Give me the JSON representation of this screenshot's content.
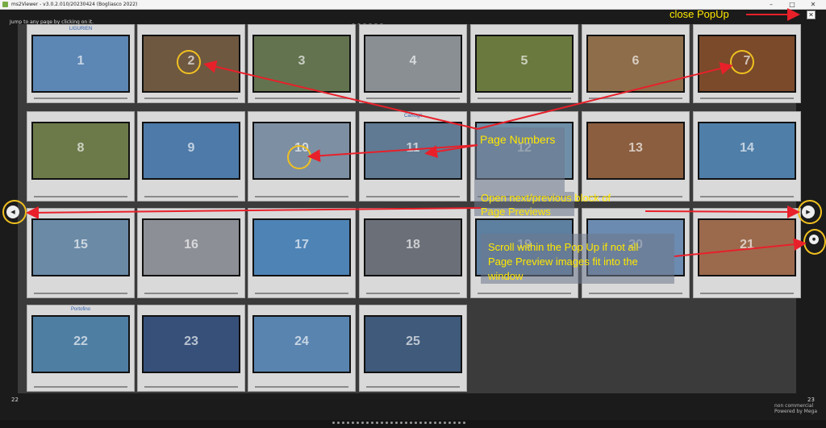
{
  "window": {
    "title": "ms2Viewer - v3.0.2.010/20230424 (Bogliasco 2022)",
    "minimize": "–",
    "maximize": "□",
    "close": "✕"
  },
  "popup": {
    "hint": "Jump to any page by clicking on it.",
    "close_symbol": "✕",
    "left_page": "22",
    "right_page": "23"
  },
  "thumbnails": [
    {
      "num": "1",
      "title": "LIGURIEN",
      "color": "#5c86b4"
    },
    {
      "num": "2",
      "title": "",
      "color": "#6e5840"
    },
    {
      "num": "3",
      "title": "",
      "color": "#63734f"
    },
    {
      "num": "4",
      "title": "",
      "color": "#8a8f94"
    },
    {
      "num": "5",
      "title": "",
      "color": "#6a7a3e"
    },
    {
      "num": "6",
      "title": "",
      "color": "#8e6d4a"
    },
    {
      "num": "7",
      "title": "",
      "color": "#7a4a2a"
    },
    {
      "num": "8",
      "title": "",
      "color": "#6c7a4a"
    },
    {
      "num": "9",
      "title": "",
      "color": "#4d7aa8"
    },
    {
      "num": "10",
      "title": "",
      "color": "#7d8fa2"
    },
    {
      "num": "11",
      "title": "Camogli",
      "color": "#5f7a92"
    },
    {
      "num": "12",
      "title": "",
      "color": "#6f8fa8"
    },
    {
      "num": "13",
      "title": "",
      "color": "#8a5e3f"
    },
    {
      "num": "14",
      "title": "",
      "color": "#4f7ea8"
    },
    {
      "num": "15",
      "title": "",
      "color": "#6a8aa6"
    },
    {
      "num": "16",
      "title": "",
      "color": "#8c8f95"
    },
    {
      "num": "17",
      "title": "",
      "color": "#4e83b5"
    },
    {
      "num": "18",
      "title": "",
      "color": "#6a6f78"
    },
    {
      "num": "19",
      "title": "",
      "color": "#5d7fa0"
    },
    {
      "num": "20",
      "title": "",
      "color": "#6b8bb0"
    },
    {
      "num": "21",
      "title": "",
      "color": "#9b6a4d"
    },
    {
      "num": "22",
      "title": "Portofino",
      "color": "#4f7ea3"
    },
    {
      "num": "23",
      "title": "",
      "color": "#36507a"
    },
    {
      "num": "24",
      "title": "",
      "color": "#5a84b0"
    },
    {
      "num": "25",
      "title": "",
      "color": "#3f5a7a"
    }
  ],
  "annotations": {
    "close_popup": "close PopUp",
    "page_numbers": "Page Numbers",
    "open_block_line1": "Open next/previous block of",
    "open_block_line2": "Page Previews",
    "scroll_line1": "Scroll within the Pop Up if not all",
    "scroll_line2": "Page Preview images fit into the",
    "scroll_line3": "window"
  },
  "nav": {
    "prev_symbol": "◀",
    "next_symbol": "▶",
    "scroll_symbol": "●"
  },
  "footer": {
    "line1": "non commercial",
    "line2": "Powered by Mega"
  },
  "colors": {
    "annotation": "#ffe800",
    "arrow": "#e8202a",
    "circle": "#f0c020"
  }
}
